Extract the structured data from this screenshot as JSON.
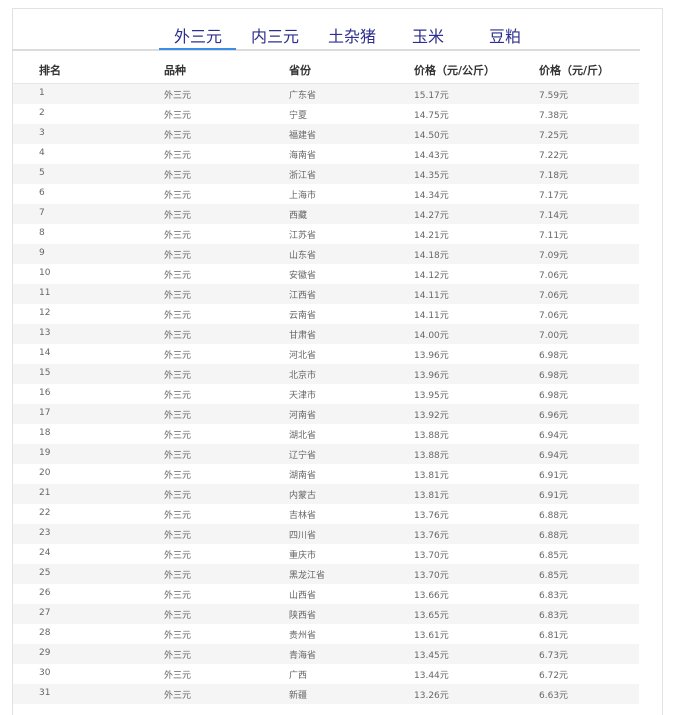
{
  "tabs": [
    {
      "label": "外三元"
    },
    {
      "label": "内三元"
    },
    {
      "label": "土杂猪"
    },
    {
      "label": "玉米"
    },
    {
      "label": "豆粕"
    }
  ],
  "table": {
    "headers": [
      "排名",
      "品种",
      "省份",
      "价格（元/公斤）",
      "价格（元/斤）"
    ],
    "rows": [
      [
        "1",
        "外三元",
        "广东省",
        "15.17元",
        "7.59元"
      ],
      [
        "2",
        "外三元",
        "宁夏",
        "14.75元",
        "7.38元"
      ],
      [
        "3",
        "外三元",
        "福建省",
        "14.50元",
        "7.25元"
      ],
      [
        "4",
        "外三元",
        "海南省",
        "14.43元",
        "7.22元"
      ],
      [
        "5",
        "外三元",
        "浙江省",
        "14.35元",
        "7.18元"
      ],
      [
        "6",
        "外三元",
        "上海市",
        "14.34元",
        "7.17元"
      ],
      [
        "7",
        "外三元",
        "西藏",
        "14.27元",
        "7.14元"
      ],
      [
        "8",
        "外三元",
        "江苏省",
        "14.21元",
        "7.11元"
      ],
      [
        "9",
        "外三元",
        "山东省",
        "14.18元",
        "7.09元"
      ],
      [
        "10",
        "外三元",
        "安徽省",
        "14.12元",
        "7.06元"
      ],
      [
        "11",
        "外三元",
        "江西省",
        "14.11元",
        "7.06元"
      ],
      [
        "12",
        "外三元",
        "云南省",
        "14.11元",
        "7.06元"
      ],
      [
        "13",
        "外三元",
        "甘肃省",
        "14.00元",
        "7.00元"
      ],
      [
        "14",
        "外三元",
        "河北省",
        "13.96元",
        "6.98元"
      ],
      [
        "15",
        "外三元",
        "北京市",
        "13.96元",
        "6.98元"
      ],
      [
        "16",
        "外三元",
        "天津市",
        "13.95元",
        "6.98元"
      ],
      [
        "17",
        "外三元",
        "河南省",
        "13.92元",
        "6.96元"
      ],
      [
        "18",
        "外三元",
        "湖北省",
        "13.88元",
        "6.94元"
      ],
      [
        "19",
        "外三元",
        "辽宁省",
        "13.88元",
        "6.94元"
      ],
      [
        "20",
        "外三元",
        "湖南省",
        "13.81元",
        "6.91元"
      ],
      [
        "21",
        "外三元",
        "内蒙古",
        "13.81元",
        "6.91元"
      ],
      [
        "22",
        "外三元",
        "吉林省",
        "13.76元",
        "6.88元"
      ],
      [
        "23",
        "外三元",
        "四川省",
        "13.76元",
        "6.88元"
      ],
      [
        "24",
        "外三元",
        "重庆市",
        "13.70元",
        "6.85元"
      ],
      [
        "25",
        "外三元",
        "黑龙江省",
        "13.70元",
        "6.85元"
      ],
      [
        "26",
        "外三元",
        "山西省",
        "13.66元",
        "6.83元"
      ],
      [
        "27",
        "外三元",
        "陕西省",
        "13.65元",
        "6.83元"
      ],
      [
        "28",
        "外三元",
        "贵州省",
        "13.61元",
        "6.81元"
      ],
      [
        "29",
        "外三元",
        "青海省",
        "13.45元",
        "6.73元"
      ],
      [
        "30",
        "外三元",
        "广西",
        "13.44元",
        "6.72元"
      ],
      [
        "31",
        "外三元",
        "新疆",
        "13.26元",
        "6.63元"
      ]
    ]
  }
}
